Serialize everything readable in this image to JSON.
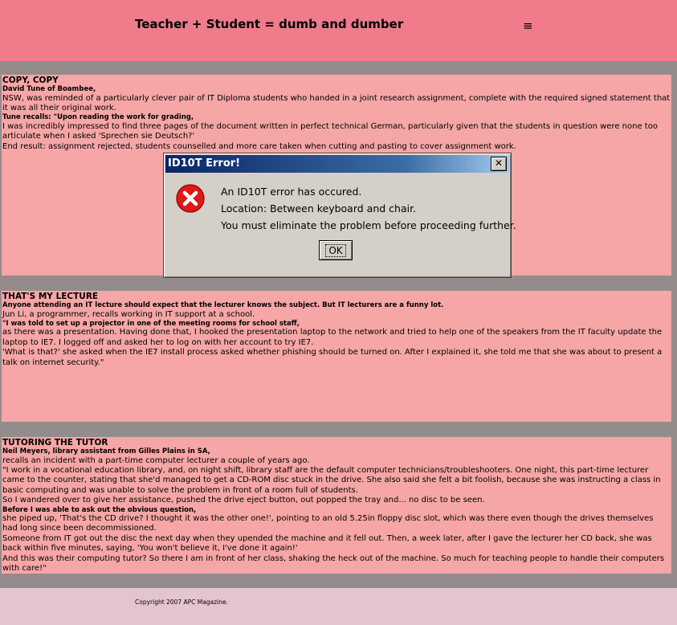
{
  "header": {
    "title": "Teacher + Student = dumb and dumber",
    "menu_icon": "≡"
  },
  "sections": [
    {
      "heading": "COPY, COPY",
      "lines": [
        {
          "bold": true,
          "text": "David Tune of Boambee,"
        },
        {
          "bold": false,
          "text": "NSW, was reminded of a particularly clever pair of IT Diploma students who handed in a joint research assignment, complete with the required signed statement that it was all their original work."
        },
        {
          "bold": true,
          "text": "Tune recalls: \"Upon reading the work for grading,"
        },
        {
          "bold": false,
          "text": "I was incredibly impressed to find three pages of the document written in perfect technical German, particularly given that the students in question were none too articulate when I asked 'Sprechen sie Deutsch?'"
        },
        {
          "bold": false,
          "text": "End result: assignment rejected, students counselled and more care taken when cutting and pasting to cover assignment work."
        }
      ]
    },
    {
      "heading": "THAT'S MY LECTURE",
      "lines": [
        {
          "bold": true,
          "text": "Anyone attending an IT lecture should expect that the lecturer knows the subject. But IT lecturers are a funny lot."
        },
        {
          "bold": false,
          "text": "Jun Li, a programmer, recalls working in IT support at a school."
        },
        {
          "bold": true,
          "text": "\"I was told to set up a projector in one of the meeting rooms for school staff,"
        },
        {
          "bold": false,
          "text": "as there was a presentation. Having done that, I hooked the presentation laptop to the network and tried to help one of the speakers from the IT faculty update the laptop to IE7. I logged off and asked her to log on with her account to try IE7."
        },
        {
          "bold": false,
          "text": "'What is that?' she asked when the IE7 install process asked whether phishing should be turned on. After I explained it, she told me that she was about to present a talk on internet security.\""
        }
      ]
    },
    {
      "heading": "TUTORING THE TUTOR",
      "lines": [
        {
          "bold": true,
          "text": "Neil Meyers, library assistant from Gilles Plains in SA,"
        },
        {
          "bold": false,
          "text": "recalls an incident with a part-time computer lecturer a couple of years ago."
        },
        {
          "bold": false,
          "text": "\"I work in a vocational education library, and, on night shift, library staff are the default computer technicians/troubleshooters. One night, this part-time lecturer came to the counter, stating that she'd managed to get a CD-ROM disc stuck in the drive. She also said she felt a bit foolish, because she was instructing a class in basic computing and was unable to solve the problem in front of a room full of students."
        },
        {
          "bold": false,
          "text": "So I wandered over to give her assistance, pushed the drive eject button, out popped the tray and... no disc to be seen."
        },
        {
          "bold": true,
          "text": "Before I was able to ask out the obvious question,"
        },
        {
          "bold": false,
          "text": "she piped up, 'That's the CD drive? I thought it was the other one!', pointing to an old 5.25in floppy disc slot, which was there even though the drives themselves had long since been decommissioned."
        },
        {
          "bold": false,
          "text": "Someone from IT got out the disc the next day when they upended the machine and it fell out. Then, a week later, after I gave the lecturer her CD back, she was back within five minutes, saying, 'You won't believe it, I've done it again!'"
        },
        {
          "bold": false,
          "text": "And this was their computing tutor? So there I am in front of her class, shaking the heck out of the machine. So much for teaching people to handle their computers with care!\""
        }
      ]
    }
  ],
  "dialog": {
    "title": "ID10T Error!",
    "close_label": "✕",
    "icon": "error-icon",
    "message_lines": [
      "An ID10T error has occured.",
      "Location: Between keyboard and chair.",
      "You must eliminate the problem before proceeding further."
    ],
    "ok_label": "OK"
  },
  "footer": {
    "copyright": "Copyright 2007 APC Magazine."
  },
  "colors": {
    "header_bg": "#f07b8a",
    "section_bg": "#f6a6a6",
    "page_bg": "#948c8c",
    "footer_bg": "#e5c4d2",
    "error_red": "#e01818"
  }
}
